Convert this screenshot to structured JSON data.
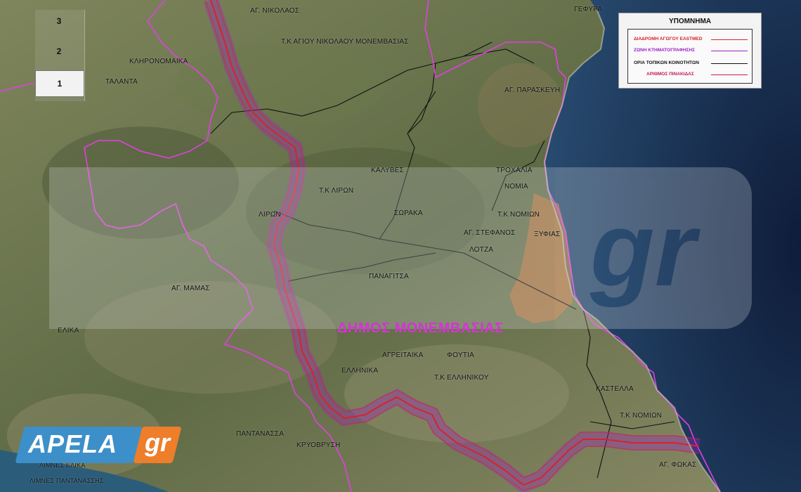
{
  "map": {
    "municipality_label": "ΔΗΜΟΣ ΜΟΝΕΜΒΑΣΙΑΣ",
    "places": [
      {
        "id": "ag-nikolaos",
        "label": "ΑΓ. ΝΙΚΟΛΑΟΣ"
      },
      {
        "id": "gefyra",
        "label": "ΓΕΦΥΡΑ"
      },
      {
        "id": "tk-ag-nikolaou",
        "label": "Τ.Κ ΑΓΙΟΥ ΝΙΚΟΛΑΟΥ ΜΟΝΕΜΒΑΣΙΑΣ"
      },
      {
        "id": "klironomaika",
        "label": "ΚΛΗΡΟΝΟΜΑΙΚΑ"
      },
      {
        "id": "talanta",
        "label": "ΤΑΛΑΝΤΑ"
      },
      {
        "id": "ag-paraskevi",
        "label": "ΑΓ. ΠΑΡΑΣΚΕΥΗ"
      },
      {
        "id": "kalyves",
        "label": "ΚΑΛΥΒΕΣ"
      },
      {
        "id": "trochalia",
        "label": "ΤΡΟΧΑΛΙΑ"
      },
      {
        "id": "nomia",
        "label": "ΝΟΜΙΑ"
      },
      {
        "id": "tk-liron",
        "label": "Τ.Κ ΛΙΡΩΝ"
      },
      {
        "id": "liron",
        "label": "ΛΙΡΩΝ"
      },
      {
        "id": "soraka",
        "label": "ΣΩΡΑΚΑ"
      },
      {
        "id": "tk-nomion",
        "label": "Τ.Κ ΝΟΜΙΩΝ"
      },
      {
        "id": "ag-stefanos",
        "label": "ΑΓ. ΣΤΕΦΑΝΟΣ"
      },
      {
        "id": "xyfias",
        "label": "ΞΥΦΙΑΣ"
      },
      {
        "id": "lotza",
        "label": "ΛΟΤΖΑ"
      },
      {
        "id": "panagitsa",
        "label": "ΠΑΝΑΓΙΤΣΑ"
      },
      {
        "id": "ag-mamas",
        "label": "ΑΓ. ΜΑΜΑΣ"
      },
      {
        "id": "elika",
        "label": "ΕΛΙΚΑ"
      },
      {
        "id": "agreitaika",
        "label": "ΑΓΡΕΙΤΑΙΚΑ"
      },
      {
        "id": "foutia",
        "label": "ΦΟΥΤΙΑ"
      },
      {
        "id": "ellinika",
        "label": "ΕΛΛΗΝΙΚΑ"
      },
      {
        "id": "tk-ellinikou",
        "label": "Τ.Κ ΕΛΛΗΝΙΚΟΥ"
      },
      {
        "id": "kastella",
        "label": "ΚΑΣΤΕΛΛΑ"
      },
      {
        "id": "tk-nomion-2",
        "label": "Τ.Κ ΝΟΜΙΩΝ"
      },
      {
        "id": "pantanassa",
        "label": "ΠΑΝΤΑΝΑΣΣΑ"
      },
      {
        "id": "kryovrysi",
        "label": "ΚΡΥΟΒΡΥΣΗ"
      },
      {
        "id": "ag-fokas",
        "label": "ΑΓ. ΦΩΚΑΣ"
      },
      {
        "id": "limnes-elika",
        "label": "ΛΙΜΝΕΣ ΕΛΙΚΑ"
      },
      {
        "id": "limnes-pantanassis",
        "label": "ΛΙΜΝΕΣ ΠΑΝΤΑΝΑΣΣΗΣ"
      }
    ]
  },
  "zoom": {
    "levels": [
      "3",
      "2",
      "1"
    ],
    "selected": "1"
  },
  "legend": {
    "title": "ΥΠΟΜΝΗΜΑ",
    "items": [
      {
        "label": "ΔΙΑΔΡΟΜΗ ΑΓΩΓΟΥ EASTMED",
        "color": "#d8232a"
      },
      {
        "label": "ΖΩΝΗ ΚΤΗΜΑΤΟΓΡΑΦΗΣΗΣ",
        "color": "#a020c8"
      },
      {
        "label": "ΟΡΙΑ ΤΟΠΙΚΩΝ ΚΟΙΝΟΤΗΤΩΝ",
        "color": "#111111"
      },
      {
        "label": "ΑΡΙΘΜΟΣ ΠΙΝΑΚΙΔΑΣ",
        "color": "#c2185b"
      }
    ]
  },
  "watermark": {
    "brand": "APELA",
    "suffix": "gr",
    "big_text": "gr"
  },
  "colors": {
    "sea": "#1d2f55",
    "terrain": "#6b7650",
    "boundary": "#e040e0",
    "pipeline": "#d8232a",
    "zone": "#8a3fd0"
  }
}
